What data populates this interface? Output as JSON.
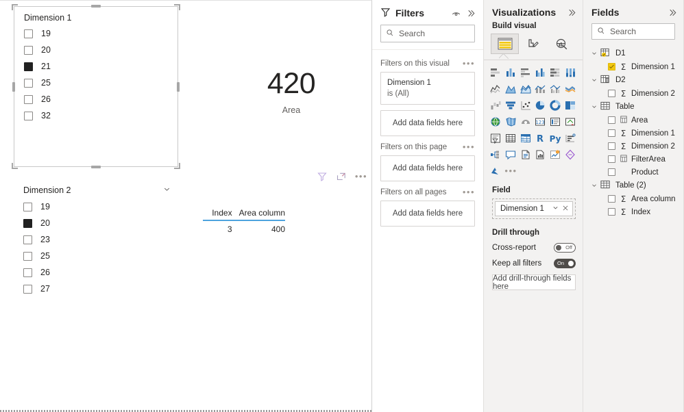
{
  "canvas": {
    "slicer1": {
      "title": "Dimension 1",
      "selected": true,
      "items": [
        {
          "value": "19",
          "checked": false
        },
        {
          "value": "20",
          "checked": false
        },
        {
          "value": "21",
          "checked": true
        },
        {
          "value": "25",
          "checked": false
        },
        {
          "value": "26",
          "checked": false
        },
        {
          "value": "32",
          "checked": false
        }
      ],
      "actions": [
        "filter-icon",
        "focus-mode-icon",
        "more-options-icon"
      ]
    },
    "slicer2": {
      "title": "Dimension 2",
      "items": [
        {
          "value": "19",
          "checked": false
        },
        {
          "value": "20",
          "checked": true
        },
        {
          "value": "23",
          "checked": false
        },
        {
          "value": "25",
          "checked": false
        },
        {
          "value": "26",
          "checked": false
        },
        {
          "value": "27",
          "checked": false
        }
      ]
    },
    "card": {
      "value": "420",
      "label": "Area"
    },
    "table": {
      "columns": [
        "Index",
        "Area column"
      ],
      "rows": [
        [
          "3",
          "400"
        ]
      ]
    }
  },
  "filters": {
    "title": "Filters",
    "search_placeholder": "Search",
    "groups": [
      {
        "title": "Filters on this visual",
        "cards": [
          {
            "line1": "Dimension 1",
            "line2": "is (All)"
          }
        ],
        "dropzone": "Add data fields here"
      },
      {
        "title": "Filters on this page",
        "cards": [],
        "dropzone": "Add data fields here"
      },
      {
        "title": "Filters on all pages",
        "cards": [],
        "dropzone": "Add data fields here"
      }
    ]
  },
  "visualizations": {
    "title": "Visualizations",
    "build_visual_label": "Build visual",
    "tabs": [
      {
        "name": "build-visual-tab",
        "selected": true
      },
      {
        "name": "format-visual-tab",
        "selected": false
      },
      {
        "name": "analytics-tab",
        "selected": false
      }
    ],
    "icons": [
      "stacked-bar-chart",
      "stacked-column-chart",
      "clustered-bar-chart",
      "clustered-column-chart",
      "100-stacked-bar-chart",
      "100-stacked-column-chart",
      "line-chart",
      "area-chart",
      "stacked-area-chart",
      "line-stacked-column-chart",
      "line-clustered-column-chart",
      "ribbon-chart",
      "waterfall-chart",
      "funnel-chart",
      "scatter-chart",
      "pie-chart",
      "donut-chart",
      "treemap",
      "map",
      "filled-map",
      "arcgis-map",
      "card",
      "multi-row-card",
      "kpi",
      "slicer",
      "table",
      "matrix",
      "r-script-visual",
      "py-visual",
      "key-influencers",
      "decomposition-tree",
      "qa-visual",
      "smart-narrative",
      "paginated-report",
      "power-apps",
      "power-automate",
      "azure-map",
      "more-visuals"
    ],
    "field_section": {
      "label": "Field",
      "chip": "Dimension 1",
      "chip_icons": [
        "chevron-down-icon",
        "remove-icon"
      ]
    },
    "drill_through": {
      "label": "Drill through",
      "cross_report": {
        "label": "Cross-report",
        "state": "Off",
        "on": false
      },
      "keep_all_filters": {
        "label": "Keep all filters",
        "state": "On",
        "on": true
      },
      "dropzone": "Add drill-through fields here"
    }
  },
  "fields": {
    "title": "Fields",
    "search_placeholder": "Search",
    "tables": [
      {
        "name": "D1",
        "icon": "table-with-key-icon",
        "expanded": true,
        "highlighted": true,
        "fields": [
          {
            "name": "Dimension 1",
            "checked": true,
            "measure": true
          }
        ]
      },
      {
        "name": "D2",
        "icon": "table-with-key-icon",
        "expanded": true,
        "highlighted": false,
        "fields": [
          {
            "name": "Dimension 2",
            "checked": false,
            "measure": true
          }
        ]
      },
      {
        "name": "Table",
        "icon": "table-icon",
        "expanded": true,
        "highlighted": false,
        "fields": [
          {
            "name": "Area",
            "checked": false,
            "measure": false,
            "calc": true
          },
          {
            "name": "Dimension 1",
            "checked": false,
            "measure": true
          },
          {
            "name": "Dimension 2",
            "checked": false,
            "measure": true
          },
          {
            "name": "FilterArea",
            "checked": false,
            "measure": false,
            "calc": true
          },
          {
            "name": "Product",
            "checked": false,
            "measure": false
          }
        ]
      },
      {
        "name": "Table (2)",
        "icon": "table-icon",
        "expanded": true,
        "highlighted": false,
        "fields": [
          {
            "name": "Area column",
            "checked": false,
            "measure": true
          },
          {
            "name": "Index",
            "checked": false,
            "measure": true
          }
        ]
      }
    ]
  },
  "colors": {
    "accent_yellow": "#f2c811",
    "table_underline": "#4da3de",
    "pane_bg": "#f3f2f1",
    "text": "#252423",
    "muted": "#605e5c"
  }
}
